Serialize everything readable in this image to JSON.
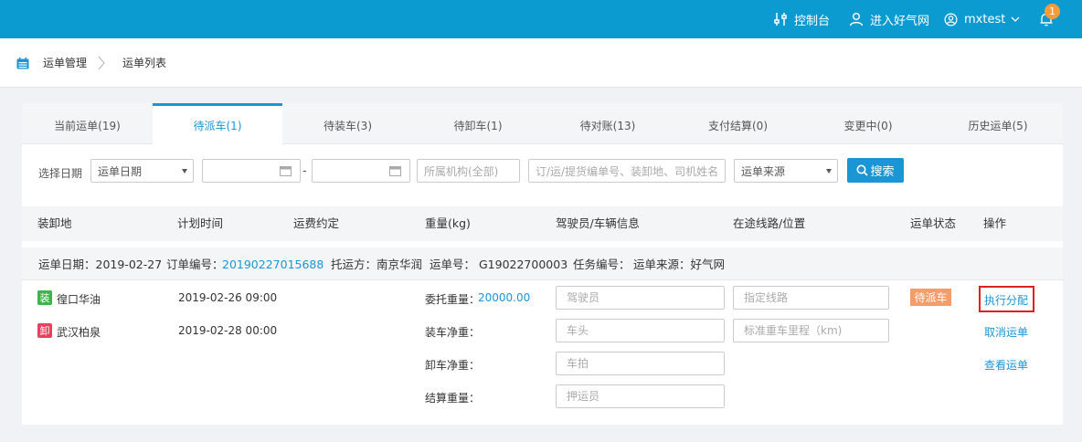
{
  "header": {
    "console_label": "控制台",
    "enter_site_label": "进入好气网",
    "username": "mxtest",
    "notification_count": "1",
    "icons": [
      "sliders-icon",
      "user-icon",
      "user-circle-icon",
      "chevron-down-icon",
      "bell-icon"
    ]
  },
  "breadcrumb": {
    "parent": "运单管理",
    "current": "运单列表"
  },
  "tabs": [
    {
      "label": "当前运单(19)",
      "active": false
    },
    {
      "label": "待派车(1)",
      "active": true
    },
    {
      "label": "待装车(3)",
      "active": false
    },
    {
      "label": "待卸车(1)",
      "active": false
    },
    {
      "label": "待对账(13)",
      "active": false
    },
    {
      "label": "支付结算(0)",
      "active": false
    },
    {
      "label": "变更中(0)",
      "active": false
    },
    {
      "label": "历史运单(5)",
      "active": false
    }
  ],
  "filters": {
    "date_label": "选择日期",
    "date_type_value": "运单日期",
    "org_placeholder": "所属机构(全部)",
    "keyword_placeholder": "订/运/提货编单号、装卸地、司机姓名",
    "source_value": "运单来源",
    "date_separator": "-",
    "search_label": "搜索"
  },
  "columns": [
    "装卸地",
    "计划时间",
    "运费约定",
    "重量(kg)",
    "驾驶员/车辆信息",
    "在途线路/位置",
    "运单状态",
    "操作"
  ],
  "order": {
    "waybill_date": "运单日期：2019-02-27",
    "order_no_label": "订单编号：",
    "order_no": "20190227015688",
    "shipper": "托运方：南京华润",
    "waybill_no": "运单号： G19022700003",
    "task_no": "任务编号：",
    "source": "运单来源：好气网",
    "load": {
      "tag": "装",
      "place": "徨口华油",
      "time": "2019-02-26 09:00",
      "tag_color": "#3cb44b"
    },
    "unload": {
      "tag": "卸",
      "place": "武汉柏泉",
      "time": "2019-02-28 00:00",
      "tag_color": "#e8415e"
    },
    "weights": {
      "entrusted_label": "委托重量：",
      "entrusted_value": "20000.00",
      "loading_label": "装车净重：",
      "unloading_label": "卸车净重：",
      "settlement_label": "结算重量："
    },
    "driver_placeholders": [
      "驾驶员",
      "车头",
      "车拍",
      "押运员"
    ],
    "route_placeholders": [
      "指定线路",
      "标准重车里程（km)"
    ],
    "status": "待派车",
    "actions": [
      "执行分配",
      "取消运单",
      "查看运单"
    ]
  },
  "colors": {
    "header_bg": "#0b9bd0",
    "accent": "#1a96d4",
    "status_bg": "#f39d6b",
    "highlight": "#e02020"
  }
}
